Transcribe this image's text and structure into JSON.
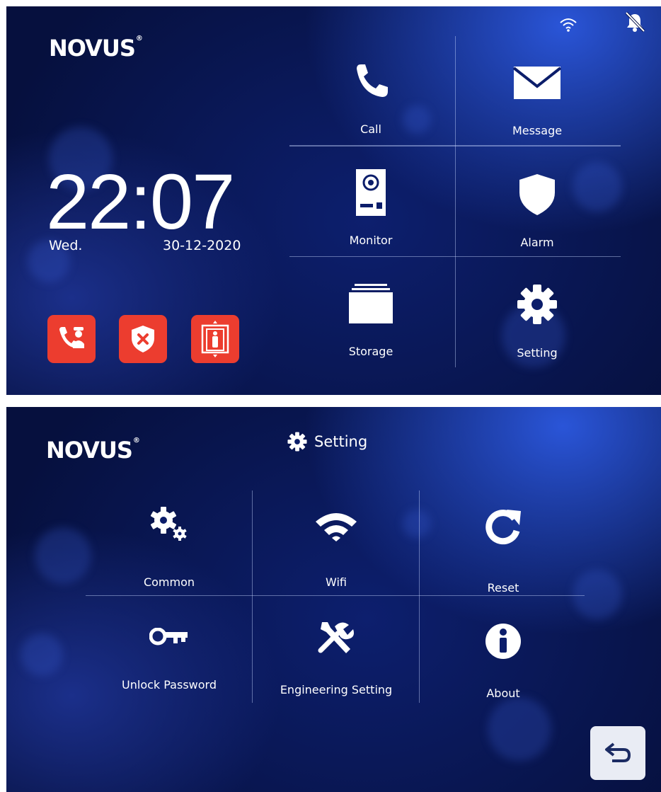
{
  "home": {
    "logo": "NOVUS",
    "time": "22:07",
    "day": "Wed.",
    "date": "30-12-2020",
    "status_icons": [
      "wifi-icon",
      "bell-muted-icon"
    ],
    "quick_actions": [
      {
        "icon": "guard-call-icon",
        "color": "#ec3d2f"
      },
      {
        "icon": "alarm-cancel-shield-icon",
        "color": "#ec3d2f"
      },
      {
        "icon": "elevator-icon",
        "color": "#ec3d2f"
      }
    ],
    "menu": [
      {
        "label": "Call",
        "icon": "phone-icon"
      },
      {
        "label": "Message",
        "icon": "envelope-icon"
      },
      {
        "label": "Monitor",
        "icon": "door-station-icon"
      },
      {
        "label": "Alarm",
        "icon": "shield-icon"
      },
      {
        "label": "Storage",
        "icon": "storage-folder-icon"
      },
      {
        "label": "Setting",
        "icon": "gear-icon"
      }
    ]
  },
  "settings": {
    "logo": "NOVUS",
    "title": "Setting",
    "title_icon": "gear-icon",
    "items": [
      {
        "label": "Common",
        "icon": "gears-icon"
      },
      {
        "label": "Wifi",
        "icon": "wifi-icon"
      },
      {
        "label": "Reset",
        "icon": "reset-icon"
      },
      {
        "label": "Unlock Password",
        "icon": "key-icon"
      },
      {
        "label": "Engineering Setting",
        "icon": "tools-icon"
      },
      {
        "label": "About",
        "icon": "info-icon"
      }
    ],
    "back_icon": "back-arrow-icon"
  },
  "colors": {
    "accent_red": "#ec3d2f",
    "background_blue": "#07134a"
  }
}
